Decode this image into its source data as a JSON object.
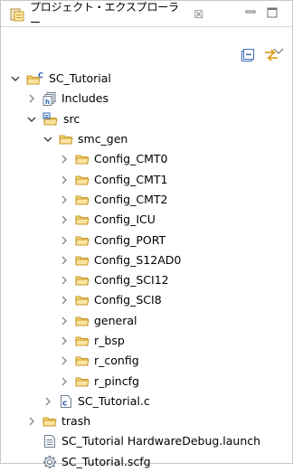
{
  "panel": {
    "tab_title": "プロジェクト・エクスプローラー",
    "close_glyph": "☒"
  },
  "tree": [
    {
      "label": "SC_Tutorial",
      "depth": 0,
      "expanded": true,
      "icon": "project-icon"
    },
    {
      "label": "Includes",
      "depth": 1,
      "expanded": false,
      "icon": "includes-icon"
    },
    {
      "label": "src",
      "depth": 1,
      "expanded": true,
      "icon": "source-folder-icon"
    },
    {
      "label": "smc_gen",
      "depth": 2,
      "expanded": true,
      "icon": "folder-icon"
    },
    {
      "label": "Config_CMT0",
      "depth": 3,
      "expanded": false,
      "icon": "folder-icon"
    },
    {
      "label": "Config_CMT1",
      "depth": 3,
      "expanded": false,
      "icon": "folder-icon"
    },
    {
      "label": "Config_CMT2",
      "depth": 3,
      "expanded": false,
      "icon": "folder-icon"
    },
    {
      "label": "Config_ICU",
      "depth": 3,
      "expanded": false,
      "icon": "folder-icon"
    },
    {
      "label": "Config_PORT",
      "depth": 3,
      "expanded": false,
      "icon": "folder-icon"
    },
    {
      "label": "Config_S12AD0",
      "depth": 3,
      "expanded": false,
      "icon": "folder-icon"
    },
    {
      "label": "Config_SCI12",
      "depth": 3,
      "expanded": false,
      "icon": "folder-icon"
    },
    {
      "label": "Config_SCI8",
      "depth": 3,
      "expanded": false,
      "icon": "folder-icon"
    },
    {
      "label": "general",
      "depth": 3,
      "expanded": false,
      "icon": "folder-icon"
    },
    {
      "label": "r_bsp",
      "depth": 3,
      "expanded": false,
      "icon": "folder-icon"
    },
    {
      "label": "r_config",
      "depth": 3,
      "expanded": false,
      "icon": "folder-icon"
    },
    {
      "label": "r_pincfg",
      "depth": 3,
      "expanded": false,
      "icon": "folder-icon"
    },
    {
      "label": "SC_Tutorial.c",
      "depth": 2,
      "expanded": false,
      "icon": "c-file-icon"
    },
    {
      "label": "trash",
      "depth": 1,
      "expanded": false,
      "icon": "folder-icon"
    },
    {
      "label": "SC_Tutorial HardwareDebug.launch",
      "depth": 1,
      "expanded": null,
      "icon": "launch-file-icon"
    },
    {
      "label": "SC_Tutorial.scfg",
      "depth": 1,
      "expanded": null,
      "icon": "gear-file-icon"
    }
  ]
}
